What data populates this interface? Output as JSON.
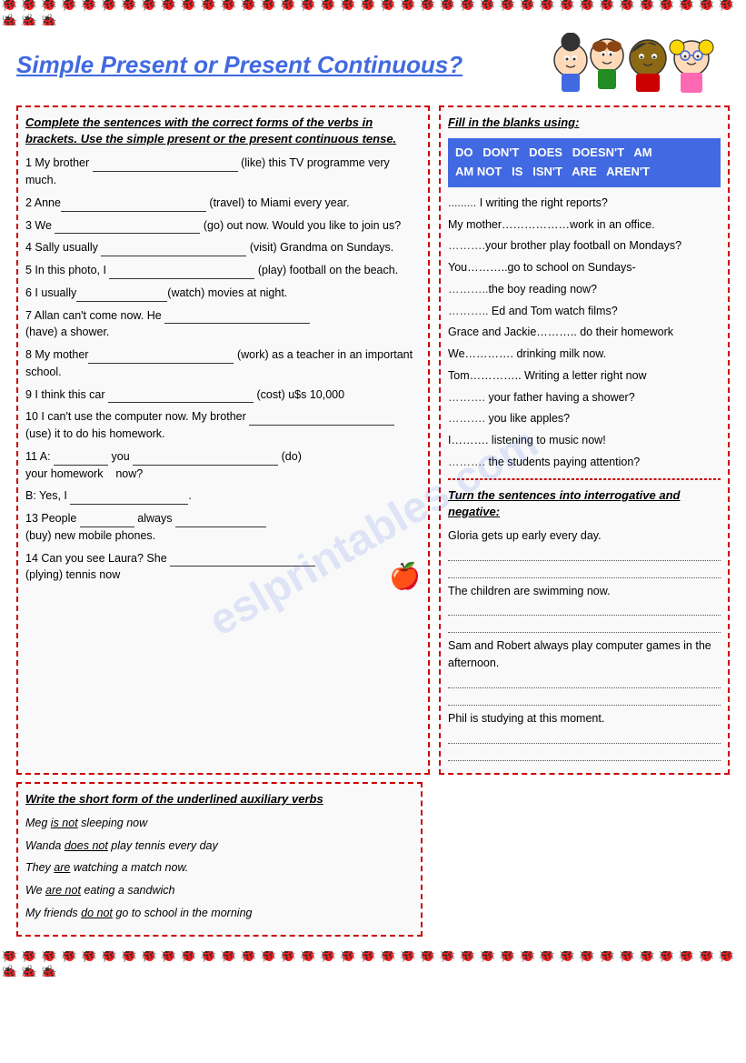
{
  "page": {
    "title": "Simple Present or Present Continuous?",
    "border_emoji": "🐞"
  },
  "left_section": {
    "instruction": "Complete the sentences with the correct forms of the verbs in brackets. Use the simple present or the present continuous tense.",
    "exercises": [
      {
        "num": "1",
        "text": "My brother",
        "blank_size": "long",
        "verb": "(like)",
        "rest": "this TV programme very much."
      },
      {
        "num": "2",
        "text": "Anne",
        "blank_size": "long",
        "verb": "(travel)",
        "rest": "to Miami every year."
      },
      {
        "num": "3",
        "text": "We",
        "blank_size": "long",
        "verb": "(go)",
        "rest": "out now. Would you like to join us?"
      },
      {
        "num": "4",
        "text": "Sally usually",
        "blank_size": "long",
        "verb": "(visit)",
        "rest": "Grandma on Sundays."
      },
      {
        "num": "5",
        "text": "In this photo, I",
        "blank_size": "long",
        "verb": "(play)",
        "rest": "football on the beach."
      },
      {
        "num": "6",
        "text": "I usually",
        "blank_size": "medium",
        "verb": "(watch)",
        "rest": "movies at night."
      },
      {
        "num": "7",
        "text": "Allan can't come now. He",
        "blank_size": "long",
        "verb": "(have)",
        "rest": "a shower."
      },
      {
        "num": "8",
        "text": "My mother",
        "blank_size": "long",
        "verb": "(work)",
        "rest": "as a teacher in an important school."
      },
      {
        "num": "9",
        "text": "I think this car",
        "blank_size": "long",
        "verb": "(cost)",
        "rest": "u$s 10,000"
      },
      {
        "num": "10",
        "text": "I can't use the computer now. My brother",
        "blank_size": "long",
        "verb": "(use)",
        "rest": "it to do his homework."
      },
      {
        "num": "11",
        "text": "A:",
        "blank_a": "short",
        "text2": "you",
        "blank_b": "long",
        "verb": "(do)",
        "rest": "your homework    now?"
      },
      {
        "num": "",
        "text": "B: Yes, I",
        "blank_size": "medium",
        "rest": "."
      },
      {
        "num": "13",
        "text": "People",
        "blank_size": "short",
        "text2": "always",
        "blank_size2": "medium",
        "verb": "(buy)",
        "rest": "new mobile phones."
      },
      {
        "num": "14",
        "text": "Can you see Laura? She",
        "blank_size": "long",
        "verb": "(plying)",
        "rest": "tennis now"
      }
    ]
  },
  "right_section": {
    "fill_instruction": "Fill in the blanks using:",
    "word_bank": "DO  DON'T  DOES  DOESN'T  AM\nAM NOT  IS  ISN'T  ARE  AREN'T",
    "fill_items": [
      "......... I writing the right reports?",
      "My mother………………work in an office.",
      "………..your brother play football on Mondays?",
      "You………..go to school on Sundays-",
      "………..the boy reading now?",
      "……….. Ed and Tom watch films?",
      "Grace and Jackie……….. do their homework",
      "We…………. drinking milk now.",
      "Tom………….. Writing a letter right now",
      "……….. your father having a shower?",
      "……….. you like apples?",
      "I………. listening to music now!",
      "……….. the students paying attention?"
    ],
    "turn_instruction": "Turn the sentences into interrogative and negative:",
    "turn_items": [
      "Gloria gets up early every day.",
      "The children are swimming now.",
      "Sam and Robert always play computer games in the afternoon.",
      "Phil is studying at this moment."
    ]
  },
  "short_form_section": {
    "instruction": "Write the short form of the underlined auxiliary verbs",
    "sentences": [
      {
        "text": "Meg ",
        "underlined": "is not",
        "rest": " sleeping now"
      },
      {
        "text": "Wanda ",
        "underlined": "does not",
        "rest": " play tennis every day"
      },
      {
        "text": "They ",
        "underlined": "are",
        "rest": " watching a match now."
      },
      {
        "text": "We ",
        "underlined": "are not",
        "rest": " eating a sandwich"
      },
      {
        "text": "My friends ",
        "underlined": "do not",
        "rest": " go to school in the morning"
      }
    ]
  }
}
